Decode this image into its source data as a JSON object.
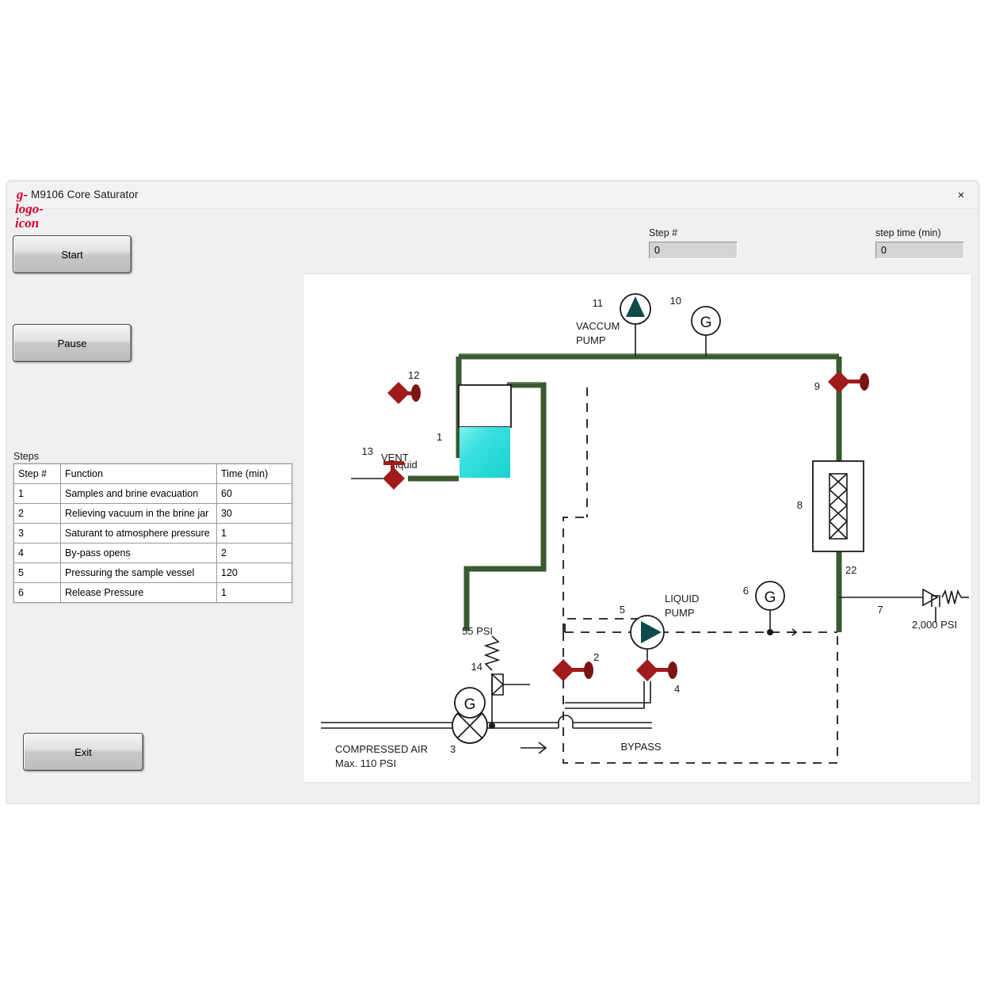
{
  "window": {
    "title": "M9106 Core Saturator",
    "logo_icon": "g-logo-icon",
    "close_icon": "×"
  },
  "controls": {
    "start_label": "Start",
    "pause_label": "Pause",
    "exit_label": "Exit"
  },
  "indicators": {
    "step_number_label": "Step #",
    "step_number_value": "0",
    "step_time_label": "step time (min)",
    "step_time_value": "0"
  },
  "steps_panel": {
    "caption": "Steps",
    "columns": [
      "Step #",
      "Function",
      "Time (min)"
    ],
    "rows": [
      {
        "step": "1",
        "function": "Samples and brine evacuation",
        "time": "60"
      },
      {
        "step": "2",
        "function": "Relieving vacuum in the brine jar",
        "time": "30"
      },
      {
        "step": "3",
        "function": "Saturant to atmosphere pressure",
        "time": "1"
      },
      {
        "step": "4",
        "function": "By-pass opens",
        "time": "2"
      },
      {
        "step": "5",
        "function": "Pressuring the sample vessel",
        "time": "120"
      },
      {
        "step": "6",
        "function": "Release Pressure",
        "time": "1"
      }
    ]
  },
  "diagram": {
    "vacuum_pump_label_line1": "VACCUM",
    "vacuum_pump_label_line2": "PUMP",
    "liquid_pump_label_line1": "LIQUID",
    "liquid_pump_label_line2": "PUMP",
    "vent_label": "VENT",
    "liquid_label": "Liquid",
    "bypass_label": "BYPASS",
    "compressed_air_line1": "COMPRESSED AIR",
    "compressed_air_line2": "Max. 110 PSI",
    "relief_55_label": "55 PSI",
    "relief_2000_label": "2,000 PSI",
    "gauge_glyph": "G",
    "tags": {
      "tank": "1",
      "valve2": "2",
      "air_valve3": "3",
      "valve4": "4",
      "liquid_pump5": "5",
      "gauge6": "6",
      "relief7": "7",
      "vessel8": "8",
      "valve9": "9",
      "gauge10": "10",
      "vacuum_pump11": "11",
      "valve12": "12",
      "valve13": "13",
      "relief14": "14",
      "line22": "22"
    },
    "colors": {
      "pipe": "#3a5a32",
      "valve": "#a01c1c",
      "liquid": "#2fe0e0",
      "pump_fill": "#0f4a4a"
    }
  }
}
